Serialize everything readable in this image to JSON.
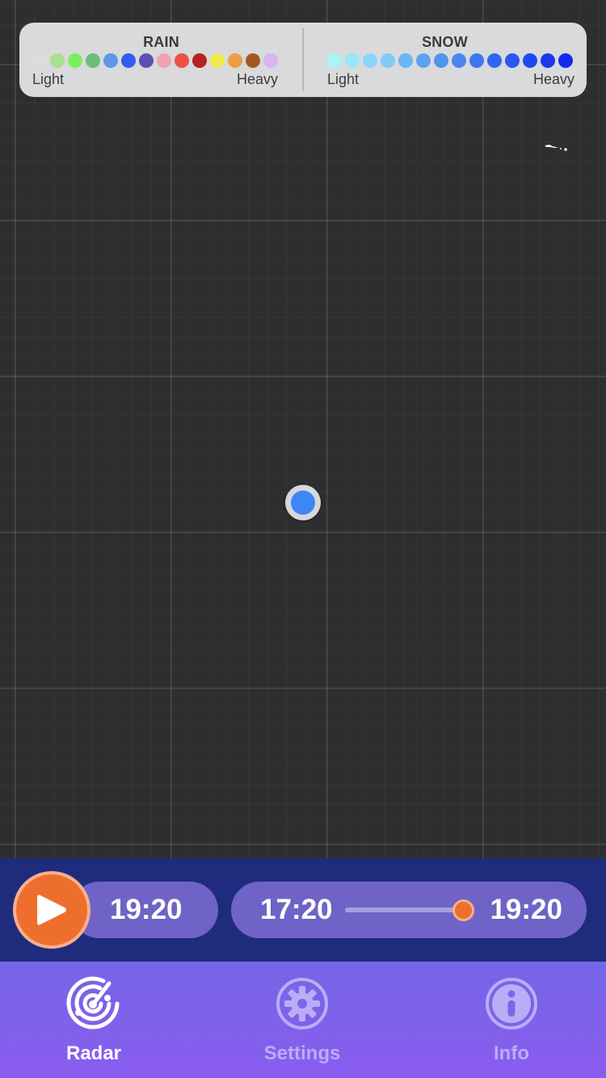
{
  "legend": {
    "rain": {
      "title": "RAIN",
      "low_label": "Light",
      "high_label": "Heavy",
      "colors": [
        "#dcdcdc",
        "#a7e08f",
        "#7af05a",
        "#6cbd7d",
        "#5f97e6",
        "#2f5ef0",
        "#5c4fb5",
        "#f2a2b4",
        "#ee5046",
        "#b72222",
        "#f4e94c",
        "#ee9e42",
        "#a25a20",
        "#d8b4f4"
      ]
    },
    "snow": {
      "title": "SNOW",
      "low_label": "Light",
      "high_label": "Heavy",
      "colors": [
        "#a8f4f8",
        "#97e6fa",
        "#8ad6fb",
        "#7ccbf8",
        "#6cb6f3",
        "#5fa1ef",
        "#5493f0",
        "#4a86f1",
        "#3d78f1",
        "#3066f1",
        "#2758f0",
        "#2048ef",
        "#1a39ef",
        "#1429ee"
      ]
    }
  },
  "playback": {
    "current_time": "19:20",
    "range_start": "17:20",
    "range_end": "19:20",
    "slider_position": 1.0
  },
  "tabs": [
    {
      "label": "Radar",
      "icon": "radar-icon",
      "active": true
    },
    {
      "label": "Settings",
      "icon": "gear-icon",
      "active": false
    },
    {
      "label": "Info",
      "icon": "info-icon",
      "active": false
    }
  ],
  "colors": {
    "accent_orange": "#ee6f2d",
    "pill_purple": "#6f63c7",
    "playback_bg": "#1f2c7e",
    "tabbar_top": "#7566e6",
    "location_blue": "#3d86f6"
  }
}
